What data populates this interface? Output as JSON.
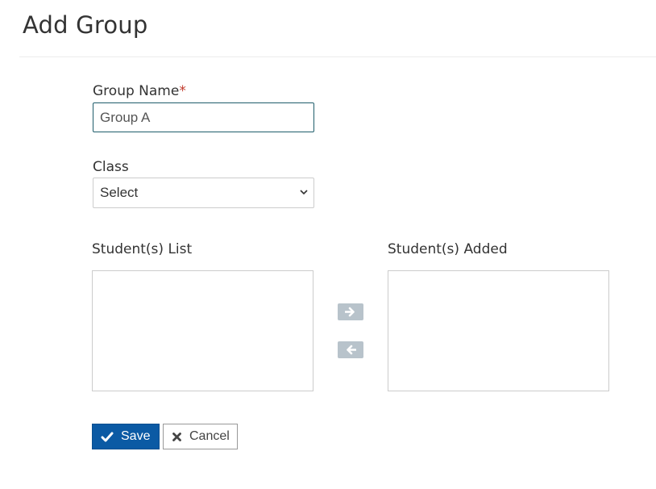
{
  "page": {
    "title": "Add Group"
  },
  "form": {
    "group_name": {
      "label": "Group Name",
      "required_marker": "*",
      "value": "Group A"
    },
    "class": {
      "label": "Class",
      "selected": "Select"
    },
    "students_list": {
      "label": "Student(s) List",
      "items": []
    },
    "students_added": {
      "label": "Student(s) Added",
      "items": []
    },
    "actions": {
      "save_label": "Save",
      "cancel_label": "Cancel"
    }
  },
  "icons": {
    "move_right": "arrow-right-icon",
    "move_left": "arrow-left-icon",
    "save": "check-icon",
    "cancel": "close-icon",
    "select": "chevron-down-icon"
  },
  "colors": {
    "primary": "#0b5aa4",
    "required": "#c0392b",
    "move_button": "#b8c3cb",
    "input_focus_border": "#1f5d6b"
  }
}
